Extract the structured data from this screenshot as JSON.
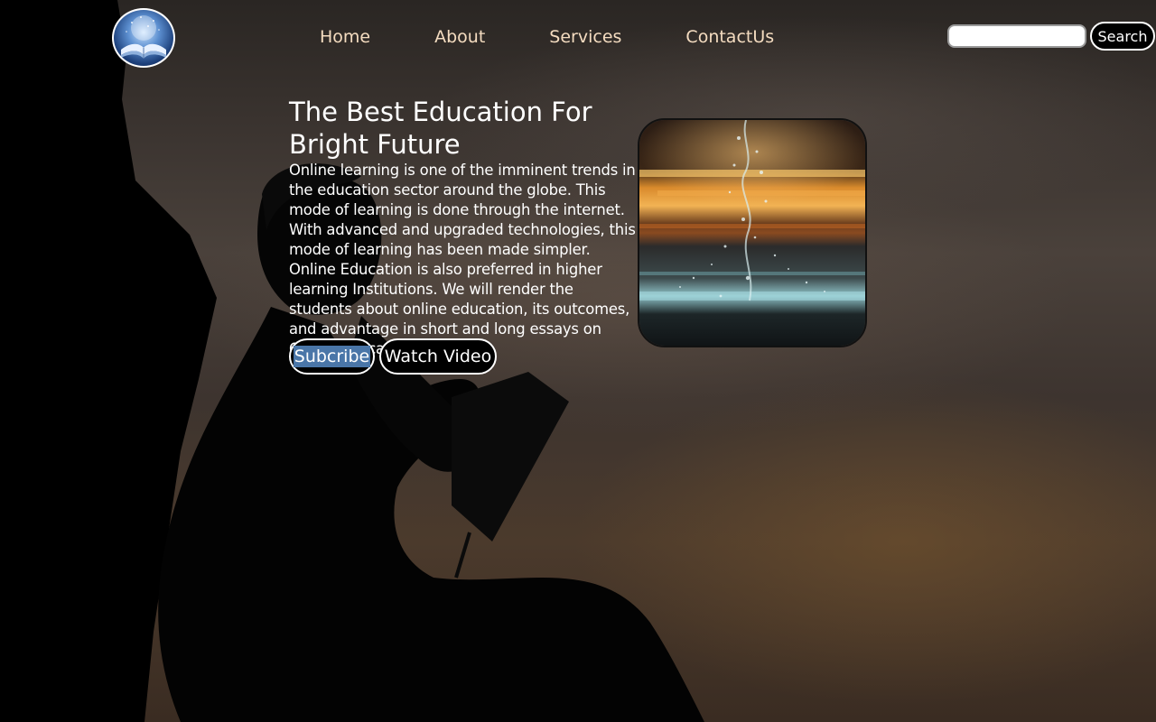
{
  "header": {
    "logo_alt": "Education logo",
    "nav": [
      {
        "label": "Home"
      },
      {
        "label": "About"
      },
      {
        "label": "Services"
      },
      {
        "label": "ContactUs"
      }
    ],
    "search": {
      "value": "",
      "placeholder": "",
      "button_label": "Search"
    }
  },
  "hero": {
    "title": "The Best Education For Bright Future",
    "body": "Online learning is one of the imminent trends in the education sector around the globe. This mode of learning is done through the internet. With advanced and upgraded technologies, this mode of learning has been made simpler. Online Education is also preferred in higher learning Institutions. We will render the students about online education, its outcomes, and advantage in short and long essays on Online Education.",
    "subscribe_label": "Subcribe",
    "watch_video_label": "Watch Video"
  },
  "colors": {
    "nav_text": "#f4dcc0",
    "selection": "#4a76a8",
    "button_bg": "#000000",
    "text": "#ffffff"
  },
  "icons": {
    "logo": "open-book-icon"
  }
}
